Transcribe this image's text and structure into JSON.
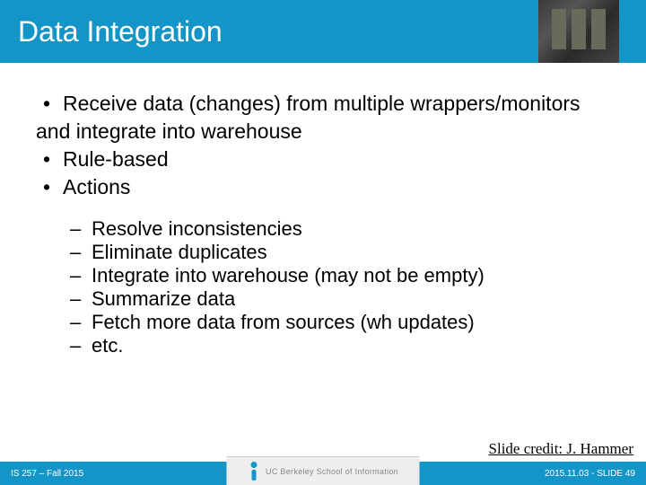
{
  "title": "Data Integration",
  "bullets": [
    "Receive data (changes) from multiple wrappers/monitors and integrate into warehouse",
    "Rule-based",
    "Actions"
  ],
  "sub_bullets": [
    "Resolve inconsistencies",
    "Eliminate duplicates",
    "Integrate into warehouse (may not be empty)",
    "Summarize data",
    "Fetch more data from sources (wh updates)",
    "etc."
  ],
  "credit": "Slide credit: J. Hammer",
  "footer": {
    "left": "IS 257 – Fall 2015",
    "center": "UC Berkeley School of Information",
    "right": "2015.11.03 - SLIDE 49"
  }
}
